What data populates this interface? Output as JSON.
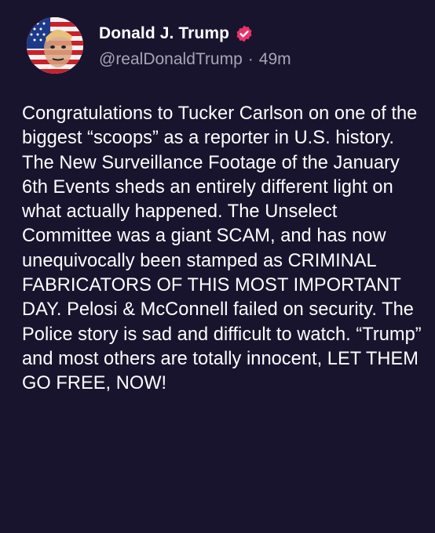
{
  "post": {
    "author_name": "Donald J. Trump",
    "handle": "@realDonaldTrump",
    "separator": "·",
    "time_ago": "49m",
    "verified_icon": "verified-badge-icon",
    "avatar_icon": "avatar-flag-portrait",
    "body": "Congratulations to Tucker Carlson on one of the biggest “scoops” as a reporter in U.S. history. The New Surveillance Footage of the January 6th Events sheds an entirely different light on what actually happened. The Unselect Committee was a giant SCAM, and has now unequivocally been stamped as CRIMINAL FABRICATORS OF THIS MOST IMPORTANT DAY. Pelosi & McConnell failed on security. The Police story is sad and difficult to watch. “Trump” and most others are totally innocent, LET THEM GO FREE, NOW!"
  },
  "colors": {
    "background": "#19142e",
    "text": "#ffffff",
    "secondary_text": "#a8a4b6",
    "verified_badge": "#e8346b"
  }
}
